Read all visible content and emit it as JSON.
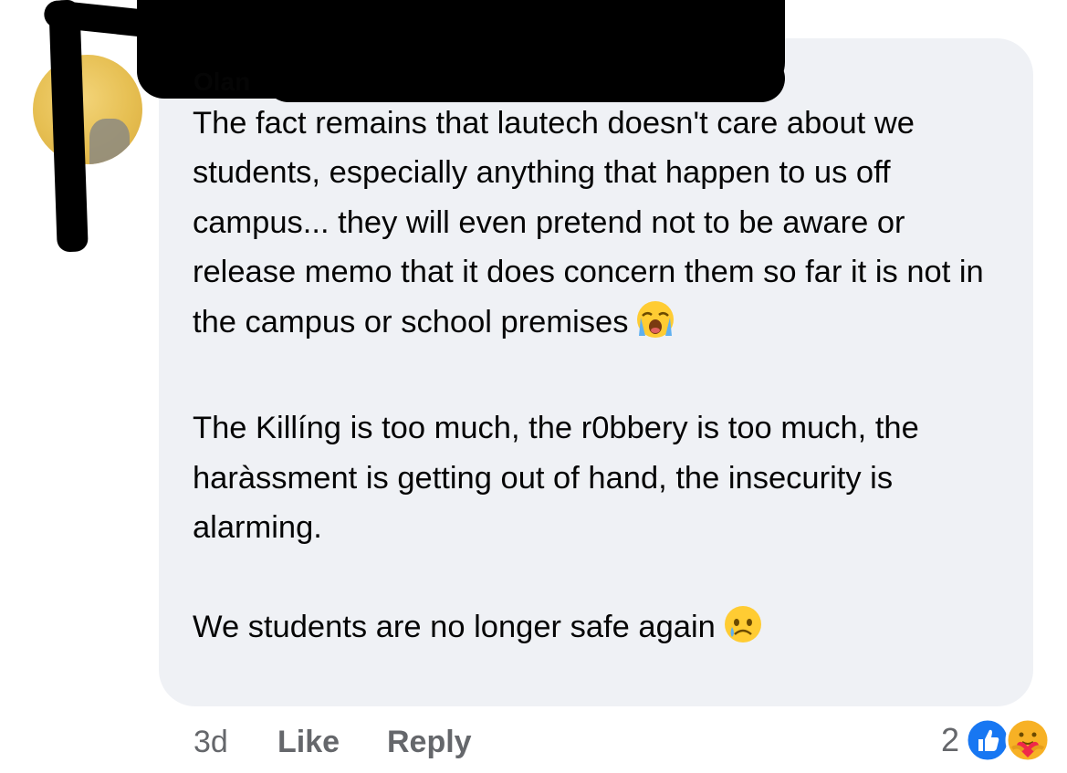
{
  "comment": {
    "author": "Olan",
    "paragraphs": [
      "The fact remains that lautech doesn't care about we students, especially anything that happen to us off campus... they will even pretend not to be aware or release memo that it does concern them so far it is not in the campus or school premises",
      "The Killíng is too much, the  r0bbery is too much, the haràssment is getting out of hand, the insecurity is alarming.",
      "We students are no longer safe again"
    ],
    "emoji_1": "loudly-crying-face-emoji",
    "emoji_2": "crying-face-emoji"
  },
  "footer": {
    "time": "3d",
    "like_label": "Like",
    "reply_label": "Reply",
    "reaction_count": "2",
    "reactions": [
      "like-icon",
      "care-icon"
    ]
  },
  "colors": {
    "bubble": "#eff1f5",
    "text": "#050505",
    "meta": "#65676b",
    "like_blue": "#1877f2"
  }
}
